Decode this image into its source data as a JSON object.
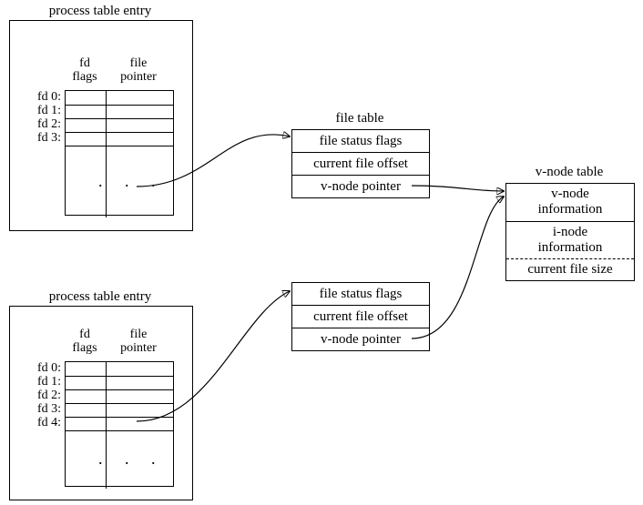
{
  "proc1": {
    "title": "process table entry",
    "hdr_flags": "fd\nflags",
    "hdr_ptr": "file\npointer",
    "rows": [
      "fd 0:",
      "fd 1:",
      "fd 2:",
      "fd 3:"
    ],
    "dots": ". . ."
  },
  "proc2": {
    "title": "process table entry",
    "hdr_flags": "fd\nflags",
    "hdr_ptr": "file\npointer",
    "rows": [
      "fd 0:",
      "fd 1:",
      "fd 2:",
      "fd 3:",
      "fd 4:"
    ],
    "dots": ". . ."
  },
  "ft_title": "file table",
  "ft1": {
    "r1": "file status flags",
    "r2": "current file offset",
    "r3": "v-node pointer"
  },
  "ft2": {
    "r1": "file status flags",
    "r2": "current file offset",
    "r3": "v-node pointer"
  },
  "vn_title": "v-node table",
  "vn": {
    "r1": "v-node\ninformation",
    "r2": "i-node\ninformation",
    "r3": "current file size"
  },
  "chart_data": {
    "type": "diagram",
    "nodes": [
      {
        "id": "proc1",
        "kind": "process_table_entry",
        "fd_rows": [
          "fd 0:",
          "fd 1:",
          "fd 2:",
          "fd 3:"
        ],
        "connected_fd": "fd 3:"
      },
      {
        "id": "proc2",
        "kind": "process_table_entry",
        "fd_rows": [
          "fd 0:",
          "fd 1:",
          "fd 2:",
          "fd 3:",
          "fd 4:"
        ],
        "connected_fd": "fd 4:"
      },
      {
        "id": "ft1",
        "kind": "file_table",
        "rows": [
          "file status flags",
          "current file offset",
          "v-node pointer"
        ]
      },
      {
        "id": "ft2",
        "kind": "file_table",
        "rows": [
          "file status flags",
          "current file offset",
          "v-node pointer"
        ]
      },
      {
        "id": "vn",
        "kind": "v_node_table",
        "rows": [
          "v-node information",
          "i-node information",
          "current file size"
        ]
      }
    ],
    "edges": [
      {
        "from": "proc1.fd3.file_pointer",
        "to": "ft1"
      },
      {
        "from": "proc2.fd4.file_pointer",
        "to": "ft2"
      },
      {
        "from": "ft1.v_node_pointer",
        "to": "vn"
      },
      {
        "from": "ft2.v_node_pointer",
        "to": "vn"
      }
    ]
  }
}
